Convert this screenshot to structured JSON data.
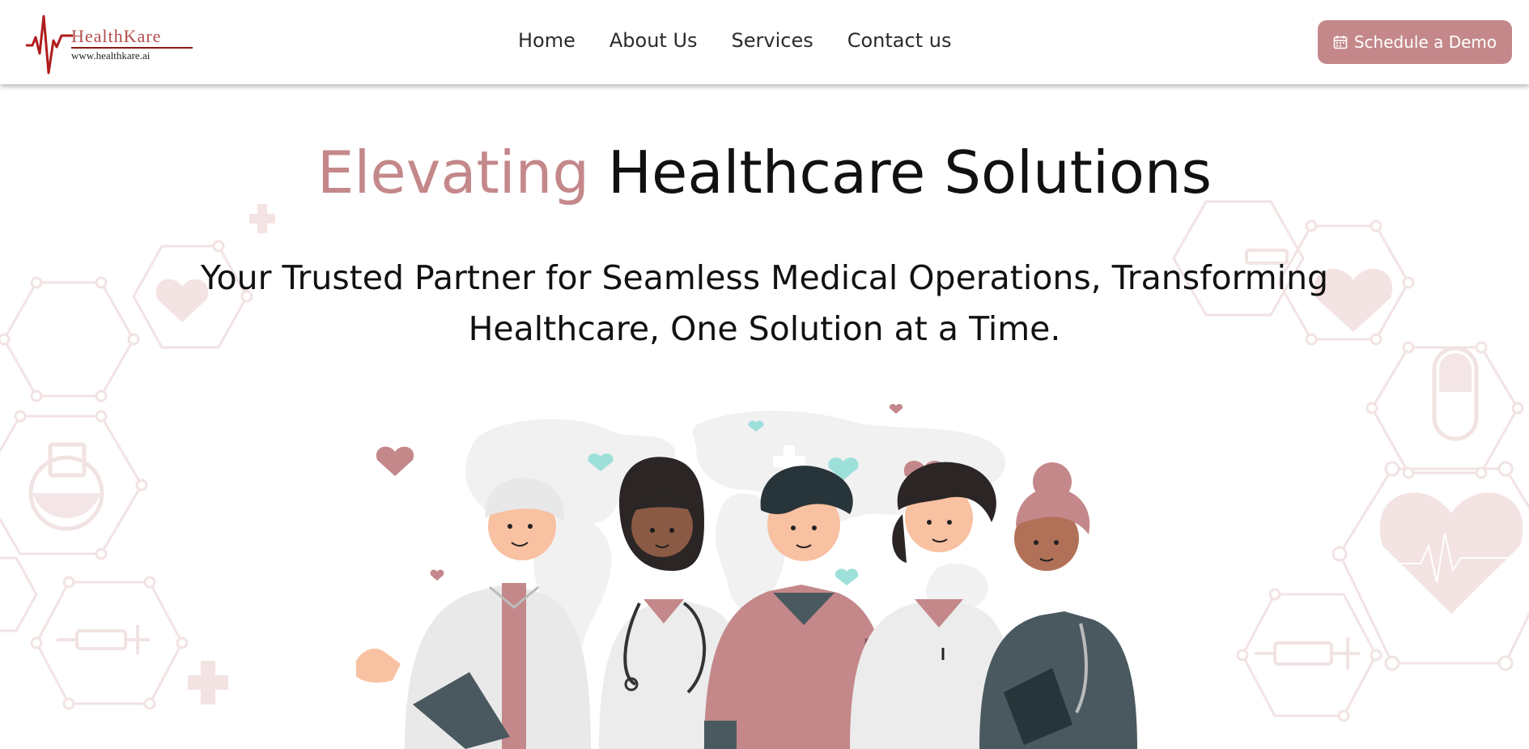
{
  "brand": {
    "logo_name": "HealthKare",
    "logo_url": "www.healthkare.ai",
    "accent_color": "#c4888a",
    "logo_color": "#b34b4b"
  },
  "nav": {
    "items": [
      {
        "label": "Home"
      },
      {
        "label": "About Us"
      },
      {
        "label": "Services"
      },
      {
        "label": "Contact us"
      }
    ]
  },
  "header": {
    "cta_label": "Schedule a Demo",
    "cta_icon": "calendar-icon"
  },
  "hero": {
    "title_accent": "Elevating",
    "title_rest": "Healthcare Solutions",
    "subtitle": "Your Trusted Partner for Seamless Medical Operations, Transforming Healthcare, One Solution at a Time."
  },
  "illustration": {
    "description_icon": "medical-team-illustration",
    "heart_colors": [
      "#c4888a",
      "#9de0da"
    ],
    "scrub_color": "#c4888a",
    "dark_scrub_color": "#4a5960"
  }
}
